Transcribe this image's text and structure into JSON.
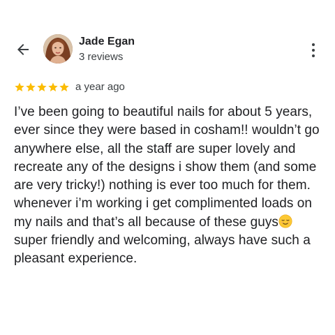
{
  "header": {
    "back_icon": "arrow-back-icon",
    "author_name": "Jade Egan",
    "author_meta": "3 reviews",
    "more_icon": "more-vert-icon"
  },
  "review": {
    "rating": 5,
    "max_rating": 5,
    "star_color": "#FBBC04",
    "time": "a year ago",
    "text_part1": "I’ve been going to beautiful nails for about 5 years, ever since they were based in cosham!! wouldn’t go anywhere else, all the staff are super lovely and recreate any of the designs i show them (and some are very tricky!) nothing is ever too much for them. whenever i’m working i get complimented loads on my nails and that’s all because of these guys",
    "emoji_icon": "relieved-face-emoji-icon",
    "text_part2": " super friendly and welcoming, always have such a pleasant experience."
  }
}
